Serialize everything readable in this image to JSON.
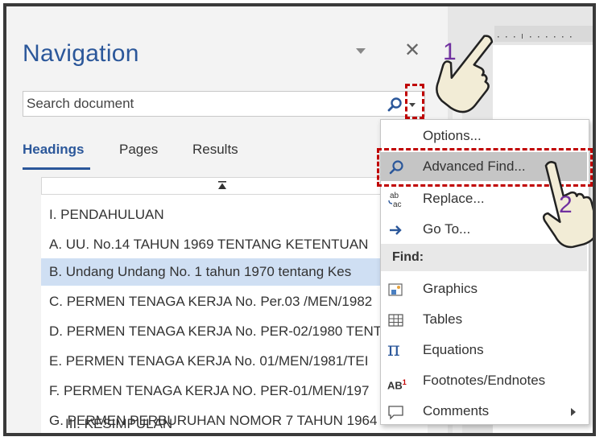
{
  "navigation": {
    "title": "Navigation",
    "search": {
      "placeholder": "Search document"
    },
    "tabs": [
      {
        "label": "Headings",
        "active": true
      },
      {
        "label": "Pages",
        "active": false
      },
      {
        "label": "Results",
        "active": false
      }
    ],
    "headings": [
      {
        "text": "I. PENDAHULUAN",
        "selected": false
      },
      {
        "text": "A. UU. No.14 TAHUN 1969 TENTANG KETENTUAN",
        "selected": false
      },
      {
        "text": "B.  Undang Undang No. 1 tahun 1970 tentang Kes",
        "selected": true
      },
      {
        "text": "C. PERMEN TENAGA KERJA No. Per.03 /MEN/1982",
        "selected": false
      },
      {
        "text": "D. PERMEN TENAGA KERJA No. PER-02/1980 TENT",
        "selected": false
      },
      {
        "text": "E. PERMEN TENAGA KERJA  No. 01/MEN/1981/TEI",
        "selected": false
      },
      {
        "text": "F.  PERMEN TENAGA KERJA NO. PER-01/MEN/197",
        "selected": false
      },
      {
        "text": "G. PERMEN PERBURUHAN NOMOR 7 TAHUN 1964",
        "selected": false
      },
      {
        "text": "III.  KESIMPULAN",
        "selected": false
      }
    ]
  },
  "menu": {
    "items": [
      {
        "label": "Options...",
        "icon": "none"
      },
      {
        "label": "Advanced Find...",
        "icon": "search-icon"
      },
      {
        "label": "Replace...",
        "icon": "replace-icon"
      },
      {
        "label": "Go To...",
        "icon": "arrow-right-icon"
      }
    ],
    "find_header": "Find:",
    "find_items": [
      {
        "label": "Graphics",
        "icon": "graphics-icon"
      },
      {
        "label": "Tables",
        "icon": "table-icon"
      },
      {
        "label": "Equations",
        "icon": "pi-icon"
      },
      {
        "label": "Footnotes/Endnotes",
        "icon": "footnote-icon"
      },
      {
        "label": "Comments",
        "icon": "comment-icon"
      }
    ]
  },
  "callouts": {
    "step1": "1",
    "step2": "2"
  },
  "colors": {
    "accent": "#2b579a",
    "highlight": "#c00000",
    "step_number": "#7030a0"
  }
}
